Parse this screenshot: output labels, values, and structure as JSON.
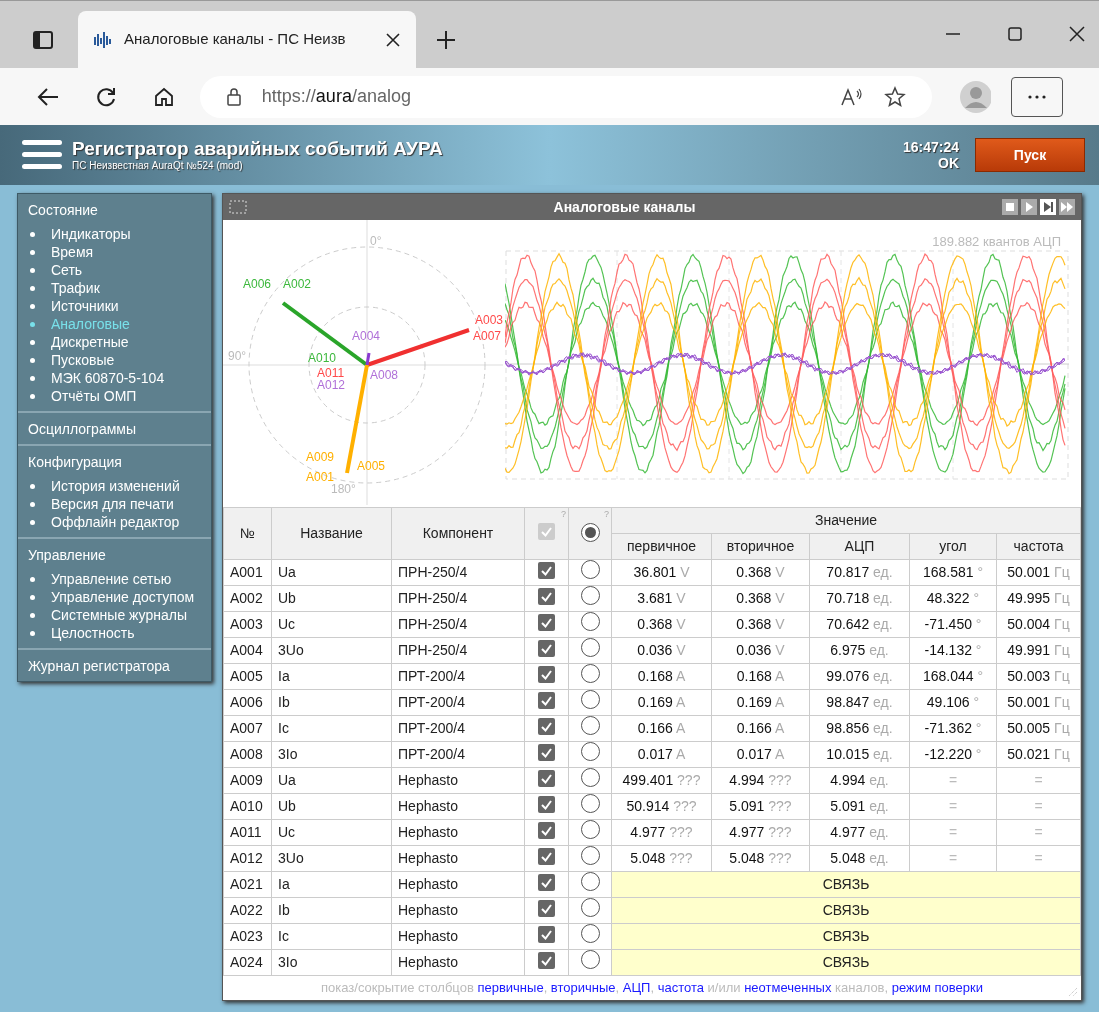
{
  "browser": {
    "tab_title": "Аналоговые каналы - ПС Неизв",
    "url": {
      "scheme": "https://",
      "host": "aura",
      "path": "/analog"
    }
  },
  "header": {
    "title": "Регистратор аварийных событий АУРА",
    "subtitle": "ПС Неизвестная AuraQt №524 (mod)",
    "time": "16:47:24",
    "status": "OK",
    "start_button": "Пуск"
  },
  "sidebar": [
    {
      "title": "Состояние",
      "items": [
        {
          "label": "Индикаторы",
          "selected": false
        },
        {
          "label": "Время",
          "selected": false
        },
        {
          "label": "Сеть",
          "selected": false
        },
        {
          "label": "Трафик",
          "selected": false
        },
        {
          "label": "Источники",
          "selected": false
        },
        {
          "label": "Аналоговые",
          "selected": true
        },
        {
          "label": "Дискретные",
          "selected": false
        },
        {
          "label": "Пусковые",
          "selected": false
        },
        {
          "label": "МЭК 60870-5-104",
          "selected": false
        },
        {
          "label": "Отчёты ОМП",
          "selected": false
        }
      ]
    },
    {
      "title": "Осциллограммы"
    },
    {
      "title": "Конфигурация",
      "items": [
        {
          "label": "История изменений",
          "selected": false
        },
        {
          "label": "Версия для печати",
          "selected": false
        },
        {
          "label": "Оффлайн редактор",
          "selected": false
        }
      ]
    },
    {
      "title": "Управление",
      "items": [
        {
          "label": "Управление сетью",
          "selected": false
        },
        {
          "label": "Управление доступом",
          "selected": false
        },
        {
          "label": "Системные журналы",
          "selected": false
        },
        {
          "label": "Целостность",
          "selected": false
        }
      ]
    },
    {
      "title": "Журнал регистратора"
    }
  ],
  "panel": {
    "title": "Аналоговые каналы",
    "controls": [
      {
        "kind": "stop",
        "selected": false
      },
      {
        "kind": "play",
        "selected": false
      },
      {
        "kind": "step",
        "selected": true
      },
      {
        "kind": "fast",
        "selected": false
      }
    ],
    "phasor": {
      "angle_labels": [
        "0°",
        "90°",
        "180°"
      ],
      "vector_labels": [
        {
          "text": "A006",
          "color": "#3cb83c"
        },
        {
          "text": "A002",
          "color": "#3cb83c"
        },
        {
          "text": "A004",
          "color": "#b070d8"
        },
        {
          "text": "A003",
          "color": "#ff4a4a"
        },
        {
          "text": "A007",
          "color": "#ff4a4a"
        },
        {
          "text": "A010",
          "color": "#3cb83c"
        },
        {
          "text": "A011",
          "color": "#ff4a4a"
        },
        {
          "text": "A012",
          "color": "#b070d8"
        },
        {
          "text": "A008",
          "color": "#b070d8"
        },
        {
          "text": "A009",
          "color": "#ffb000"
        },
        {
          "text": "A001",
          "color": "#ffb000"
        },
        {
          "text": "A005",
          "color": "#ffb000"
        }
      ]
    },
    "scale_caption": "189.882 квантов АЦП"
  },
  "table": {
    "columns": {
      "number": "№",
      "name": "Название",
      "component": "Компонент",
      "value_group": "Значение",
      "primary": "первичное",
      "secondary": "вторичное",
      "adc": "АЦП",
      "angle": "угол",
      "frequency": "частота",
      "help": "?"
    },
    "header_checkbox": {
      "checked": true,
      "disabled": true
    },
    "header_radio": {
      "selected": true
    },
    "rows": [
      {
        "kind": "values",
        "number": "A001",
        "name": "Ua",
        "component": "ПРН-250/4",
        "checked": true,
        "selected": false,
        "primary": [
          "36.801",
          "V"
        ],
        "secondary": [
          "0.368",
          "V"
        ],
        "adc": [
          "70.817",
          "ед."
        ],
        "angle": [
          "168.581",
          "°"
        ],
        "frequency": [
          "50.001",
          "Гц"
        ]
      },
      {
        "kind": "values",
        "number": "A002",
        "name": "Ub",
        "component": "ПРН-250/4",
        "checked": true,
        "selected": false,
        "primary": [
          "3.681",
          "V"
        ],
        "secondary": [
          "0.368",
          "V"
        ],
        "adc": [
          "70.718",
          "ед."
        ],
        "angle": [
          "48.322",
          "°"
        ],
        "frequency": [
          "49.995",
          "Гц"
        ]
      },
      {
        "kind": "values",
        "number": "A003",
        "name": "Uc",
        "component": "ПРН-250/4",
        "checked": true,
        "selected": false,
        "primary": [
          "0.368",
          "V"
        ],
        "secondary": [
          "0.368",
          "V"
        ],
        "adc": [
          "70.642",
          "ед."
        ],
        "angle": [
          "-71.450",
          "°"
        ],
        "frequency": [
          "50.004",
          "Гц"
        ]
      },
      {
        "kind": "values",
        "number": "A004",
        "name": "3Uo",
        "component": "ПРН-250/4",
        "checked": true,
        "selected": false,
        "primary": [
          "0.036",
          "V"
        ],
        "secondary": [
          "0.036",
          "V"
        ],
        "adc": [
          "6.975",
          "ед."
        ],
        "angle": [
          "-14.132",
          "°"
        ],
        "frequency": [
          "49.991",
          "Гц"
        ]
      },
      {
        "kind": "values",
        "number": "A005",
        "name": "Ia",
        "component": "ПРТ-200/4",
        "checked": true,
        "selected": false,
        "primary": [
          "0.168",
          "A"
        ],
        "secondary": [
          "0.168",
          "A"
        ],
        "adc": [
          "99.076",
          "ед."
        ],
        "angle": [
          "168.044",
          "°"
        ],
        "frequency": [
          "50.003",
          "Гц"
        ]
      },
      {
        "kind": "values",
        "number": "A006",
        "name": "Ib",
        "component": "ПРТ-200/4",
        "checked": true,
        "selected": false,
        "primary": [
          "0.169",
          "A"
        ],
        "secondary": [
          "0.169",
          "A"
        ],
        "adc": [
          "98.847",
          "ед."
        ],
        "angle": [
          "49.106",
          "°"
        ],
        "frequency": [
          "50.001",
          "Гц"
        ]
      },
      {
        "kind": "values",
        "number": "A007",
        "name": "Ic",
        "component": "ПРТ-200/4",
        "checked": true,
        "selected": false,
        "primary": [
          "0.166",
          "A"
        ],
        "secondary": [
          "0.166",
          "A"
        ],
        "adc": [
          "98.856",
          "ед."
        ],
        "angle": [
          "-71.362",
          "°"
        ],
        "frequency": [
          "50.005",
          "Гц"
        ]
      },
      {
        "kind": "values",
        "number": "A008",
        "name": "3Io",
        "component": "ПРТ-200/4",
        "checked": true,
        "selected": false,
        "primary": [
          "0.017",
          "A"
        ],
        "secondary": [
          "0.017",
          "A"
        ],
        "adc": [
          "10.015",
          "ед."
        ],
        "angle": [
          "-12.220",
          "°"
        ],
        "frequency": [
          "50.021",
          "Гц"
        ]
      },
      {
        "kind": "values",
        "number": "A009",
        "name": "Ua",
        "component": "Hephasto",
        "checked": true,
        "selected": false,
        "primary": [
          "499.401",
          "???"
        ],
        "secondary": [
          "4.994",
          "???"
        ],
        "adc": [
          "4.994",
          "ед."
        ],
        "angle": [
          "="
        ],
        "frequency": [
          "="
        ]
      },
      {
        "kind": "values",
        "number": "A010",
        "name": "Ub",
        "component": "Hephasto",
        "checked": true,
        "selected": false,
        "primary": [
          "50.914",
          "???"
        ],
        "secondary": [
          "5.091",
          "???"
        ],
        "adc": [
          "5.091",
          "ед."
        ],
        "angle": [
          "="
        ],
        "frequency": [
          "="
        ]
      },
      {
        "kind": "values",
        "number": "A011",
        "name": "Uc",
        "component": "Hephasto",
        "checked": true,
        "selected": false,
        "primary": [
          "4.977",
          "???"
        ],
        "secondary": [
          "4.977",
          "???"
        ],
        "adc": [
          "4.977",
          "ед."
        ],
        "angle": [
          "="
        ],
        "frequency": [
          "="
        ]
      },
      {
        "kind": "values",
        "number": "A012",
        "name": "3Uo",
        "component": "Hephasto",
        "checked": true,
        "selected": false,
        "primary": [
          "5.048",
          "???"
        ],
        "secondary": [
          "5.048",
          "???"
        ],
        "adc": [
          "5.048",
          "ед."
        ],
        "angle": [
          "="
        ],
        "frequency": [
          "="
        ]
      },
      {
        "kind": "link",
        "number": "A021",
        "name": "Ia",
        "component": "Hephasto",
        "checked": true,
        "selected": false,
        "status": "СВЯЗЬ"
      },
      {
        "kind": "link",
        "number": "A022",
        "name": "Ib",
        "component": "Hephasto",
        "checked": true,
        "selected": false,
        "status": "СВЯЗЬ"
      },
      {
        "kind": "link",
        "number": "A023",
        "name": "Ic",
        "component": "Hephasto",
        "checked": true,
        "selected": false,
        "status": "СВЯЗЬ"
      },
      {
        "kind": "link",
        "number": "A024",
        "name": "3Io",
        "component": "Hephasto",
        "checked": true,
        "selected": false,
        "status": "СВЯЗЬ"
      }
    ],
    "footer": [
      {
        "text": "показ/сокрытие столбцов ",
        "link": false
      },
      {
        "text": "первичные",
        "link": true
      },
      {
        "text": ", ",
        "link": false
      },
      {
        "text": "вторичные",
        "link": true
      },
      {
        "text": ", ",
        "link": false
      },
      {
        "text": "АЦП",
        "link": true
      },
      {
        "text": ", ",
        "link": false
      },
      {
        "text": "частота",
        "link": true
      },
      {
        "text": " и/или ",
        "link": false
      },
      {
        "text": "неотмеченных",
        "link": true
      },
      {
        "text": " каналов, ",
        "link": false
      },
      {
        "text": "режим поверки",
        "link": true
      }
    ]
  }
}
